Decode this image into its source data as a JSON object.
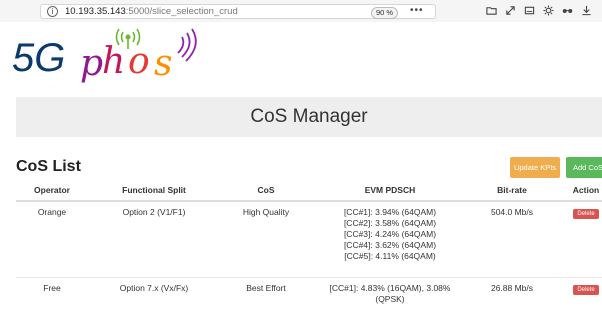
{
  "browser": {
    "url_host": "10.193.35.143",
    "url_path": ":5000/slice_selection_crud",
    "zoom": "90 %",
    "more": "•••",
    "info_glyph": "i",
    "icons": [
      "library-icon",
      "fullscreen-icon",
      "window-icon",
      "gear-icon",
      "glasses-icon",
      "download-icon"
    ]
  },
  "logo": {
    "text": "5G phos",
    "colors": {
      "five_g": "#0b3a6d",
      "p": "#8b1b8f",
      "h": "#c2185b",
      "o": "#e53935",
      "s": "#ff8f00",
      "signal": "#66bb2a",
      "waves": "#8e24aa"
    }
  },
  "header": {
    "title": "CoS Manager"
  },
  "list": {
    "title": "CoS List",
    "update_button": "Update KPIs",
    "add_button": "Add CoS"
  },
  "table": {
    "columns": [
      "Operator",
      "Functional Split",
      "CoS",
      "EVM PDSCH",
      "Bit-rate",
      "Action"
    ],
    "rows": [
      {
        "operator": "Orange",
        "split": "Option 2 (V1/F1)",
        "cos": "High Quality",
        "evm": [
          "[CC#1]: 3.94% (64QAM)",
          "[CC#2]: 3.58% (64QAM)",
          "[CC#3]: 4.24% (64QAM)",
          "[CC#4]: 3.62% (64QAM)",
          "[CC#5]: 4.11% (64QAM)"
        ],
        "bitrate": "504.0 Mb/s",
        "action": "Delete"
      },
      {
        "operator": "Free",
        "split": "Option 7.x (Vx/Fx)",
        "cos": "Best Effort",
        "evm": [
          "[CC#1]: 4.83% (16QAM), 3.08% (QPSK)"
        ],
        "bitrate": "26.88 Mb/s",
        "action": "Delete"
      }
    ]
  },
  "colors": {
    "update_button": "#f0ad4e",
    "add_button": "#5cb85c",
    "delete_button": "#d9534f",
    "jumbotron": "#eeeeee"
  }
}
